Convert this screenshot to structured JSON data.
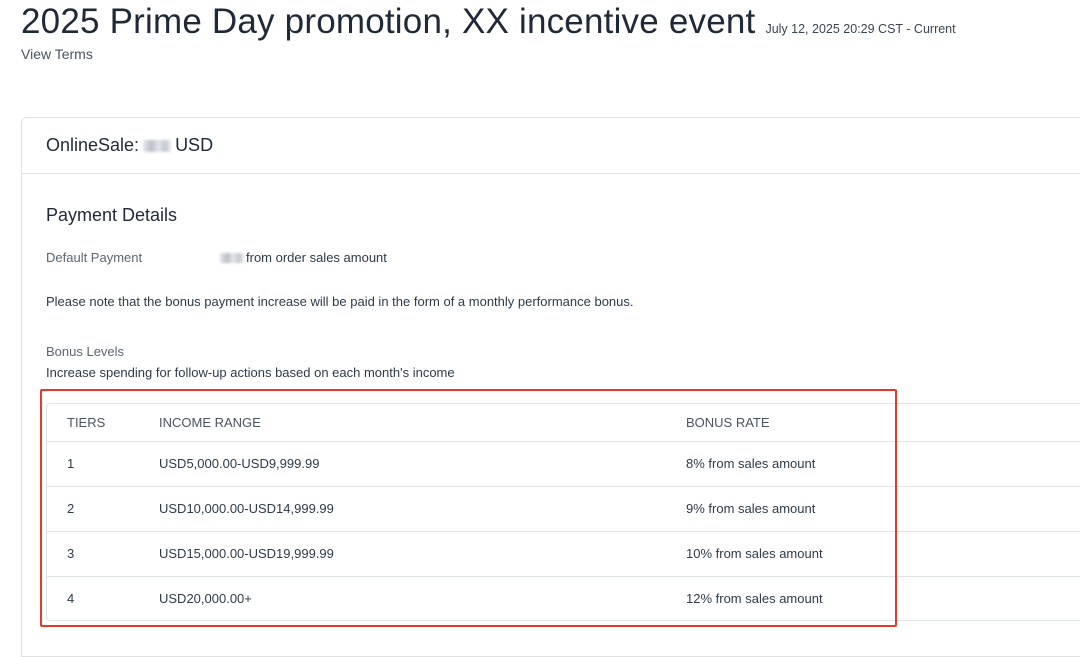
{
  "header": {
    "title": "2025 Prime Day promotion, XX incentive event",
    "period": "July 12, 2025 20:29 CST - Current",
    "view_terms": "View Terms"
  },
  "card": {
    "header_prefix": "OnlineSale:",
    "header_currency": "USD",
    "section_title": "Payment Details",
    "default_payment_label": "Default Payment",
    "default_payment_value": "from order sales amount",
    "note": "Please note that the bonus payment increase will be paid in the form of a monthly performance bonus.",
    "bonus_title": "Bonus Levels",
    "bonus_desc": "Increase spending for follow-up actions based on each month's income"
  },
  "table": {
    "headers": [
      "TIERS",
      "INCOME RANGE",
      "BONUS RATE"
    ],
    "rows": [
      {
        "tier": "1",
        "range": "USD5,000.00-USD9,999.99",
        "rate": "8% from sales amount"
      },
      {
        "tier": "2",
        "range": "USD10,000.00-USD14,999.99",
        "rate": "9% from sales amount"
      },
      {
        "tier": "3",
        "range": "USD15,000.00-USD19,999.99",
        "rate": "10% from sales amount"
      },
      {
        "tier": "4",
        "range": "USD20,000.00+",
        "rate": "12% from sales amount"
      }
    ]
  },
  "colors": {
    "highlight_border": "#e8372f",
    "text": "#2d3a4a",
    "border": "#dfe3e8"
  }
}
